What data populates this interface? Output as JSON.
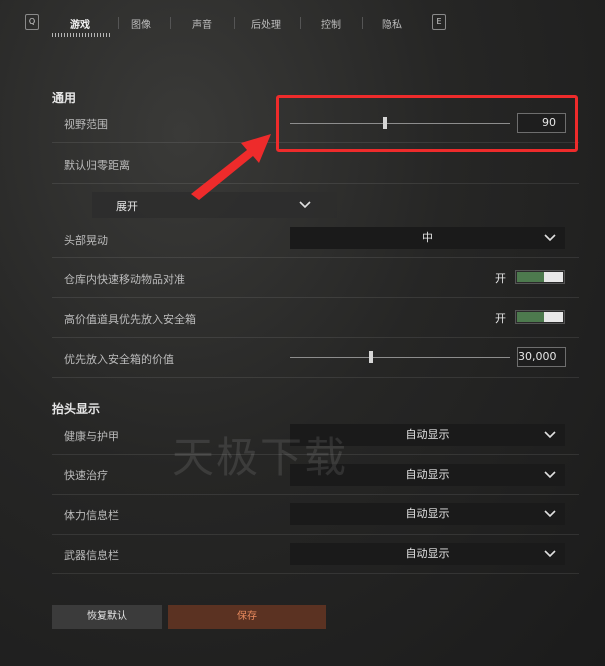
{
  "tabs": {
    "left_key": "Q",
    "right_key": "E",
    "items": [
      {
        "label": "游戏",
        "active": true
      },
      {
        "label": "图像",
        "active": false
      },
      {
        "label": "声音",
        "active": false
      },
      {
        "label": "后处理",
        "active": false
      },
      {
        "label": "控制",
        "active": false
      },
      {
        "label": "隐私",
        "active": false
      }
    ]
  },
  "general": {
    "title": "通用",
    "fov": {
      "label": "视野范围",
      "value": "90",
      "slider_fraction": 0.43
    },
    "zeroing": {
      "label": "默认归零距离"
    },
    "expand": {
      "label": "展开"
    },
    "head_bob": {
      "label": "头部晃动",
      "value": "中"
    },
    "quick_move": {
      "label": "仓库内快速移动物品对准",
      "state": "开"
    },
    "high_value_first": {
      "label": "高价值道具优先放入安全箱",
      "state": "开"
    },
    "priority_value": {
      "label": "优先放入安全箱的价值",
      "value": "30,000",
      "slider_fraction": 0.37
    }
  },
  "hud": {
    "title": "抬头显示",
    "health": {
      "label": "健康与护甲",
      "value": "自动显示"
    },
    "heal": {
      "label": "快速治疗",
      "value": "自动显示"
    },
    "stamina": {
      "label": "体力信息栏",
      "value": "自动显示"
    },
    "weapon": {
      "label": "武器信息栏",
      "value": "自动显示"
    }
  },
  "watermark": "天极下载",
  "buttons": {
    "reset": "恢复默认",
    "save": "保存"
  },
  "colors": {
    "highlight": "#ee2b2b",
    "toggle_on": "#4d7a4e",
    "save_text": "#e98a5e"
  }
}
